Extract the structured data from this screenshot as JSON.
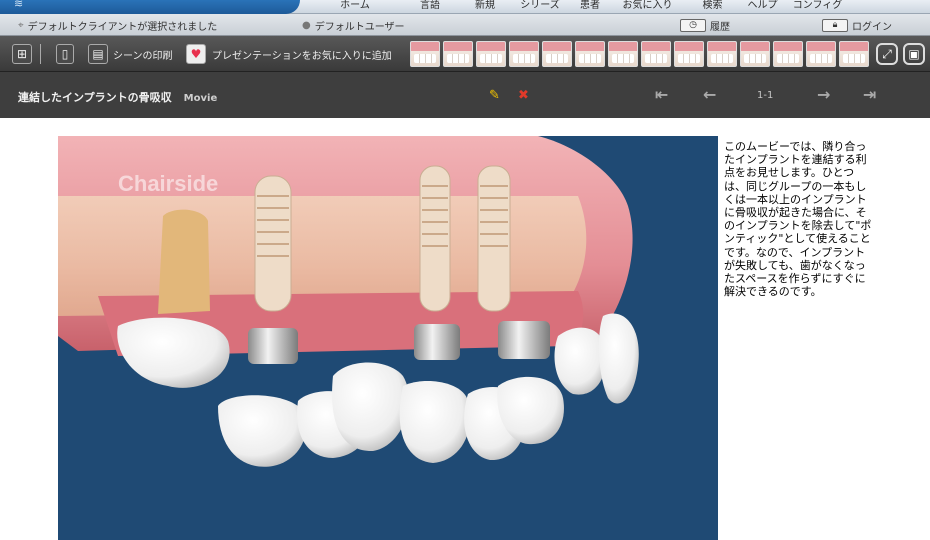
{
  "topnav": {
    "items": [
      "ホーム",
      "言語",
      "新規",
      "シリーズ",
      "患者",
      "お気に入り",
      "検索",
      "ヘルプ",
      "コンフィグ"
    ]
  },
  "status": {
    "client": "デフォルトクライアントが選択されました",
    "user": "デフォルトユーザー",
    "history": "履歴",
    "login": "ログイン"
  },
  "toolbar": {
    "print_label": "シーンの印刷",
    "favorite_label": "プレゼンテーションをお気に入りに追加"
  },
  "title": {
    "name": "連結したインプラントの骨吸収",
    "kind": "Movie",
    "page": "1-1"
  },
  "movie": {
    "watermark": "Chairside"
  },
  "description": "このムービーでは、隣り合ったインプラントを連結する利点をお見せします。ひとつは、同じグループの一本もしくは一本以上のインプラントに骨吸収が起きた場合に、そのインプラントを除去して\"ポンティック\"として使えることです。なので、インプラントが失敗しても、歯がなくなったスペースを作らずにすぐに解決できるのです。",
  "colors": {
    "toolbar": "#444444",
    "titlebar": "#3e3e3e",
    "movie_bg": "#1f4a74",
    "gum": "#e07f86"
  }
}
